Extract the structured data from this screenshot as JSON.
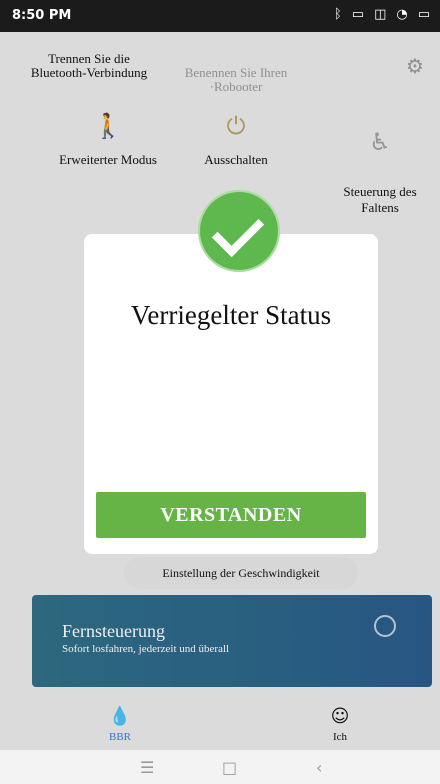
{
  "status_bar": {
    "time": "8:50 PM",
    "icons": [
      "bluetooth-icon",
      "sim-icon",
      "battery-saver-icon",
      "wifi-icon",
      "battery-icon"
    ]
  },
  "header": {
    "disconnect_label": "Trennen Sie die\nBluetooth-Verbindung",
    "rename_label": "Benennen Sie Ihren\n·Robooter",
    "settings_icon": "gear-icon"
  },
  "modes": [
    {
      "label": "Erweiterter Modus",
      "icon": "walking-person-icon"
    },
    {
      "label": "Ausschalten",
      "icon": "power-icon"
    },
    {
      "label": "Steuerung des\nFaltens",
      "icon": "wheelchair-icon"
    }
  ],
  "modal": {
    "title": "Verriegelter Status",
    "confirm_label": "VERSTANDEN",
    "icon": "checkmark-icon"
  },
  "speed_setting_label": "Einstellung der Geschwindigkeit",
  "remote": {
    "title": "Fernsteuerung",
    "subtitle": "Sofort losfahren, jederzeit und überall",
    "icon": "target-icon"
  },
  "bottom_nav": [
    {
      "label": "BBR",
      "icon": "drop-icon",
      "active": true
    },
    {
      "label": "Ich",
      "icon": "user-icon",
      "active": false
    }
  ],
  "system_nav": {
    "menu_icon": "menu-icon",
    "home_icon": "home-square-icon",
    "back_icon": "back-icon"
  }
}
